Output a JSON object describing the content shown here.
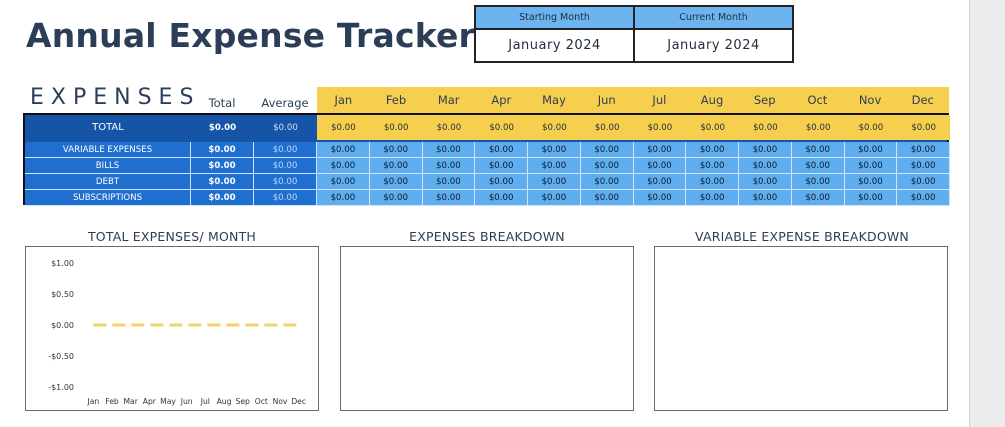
{
  "title": "Annual Expense Tracker",
  "month_box": {
    "starting_label": "Starting Month",
    "starting_value": "January  2024",
    "current_label": "Current Month",
    "current_value": "January  2024"
  },
  "table": {
    "section_label": "EXPENSES",
    "total_header": "Total",
    "average_header": "Average",
    "months": [
      "Jan",
      "Feb",
      "Mar",
      "Apr",
      "May",
      "Jun",
      "Jul",
      "Aug",
      "Sep",
      "Oct",
      "Nov",
      "Dec"
    ],
    "rows": [
      {
        "name": "TOTAL",
        "total": "$0.00",
        "average": "$0.00",
        "values": [
          "$0.00",
          "$0.00",
          "$0.00",
          "$0.00",
          "$0.00",
          "$0.00",
          "$0.00",
          "$0.00",
          "$0.00",
          "$0.00",
          "$0.00",
          "$0.00"
        ]
      },
      {
        "name": "VARIABLE EXPENSES",
        "total": "$0.00",
        "average": "$0.00",
        "values": [
          "$0.00",
          "$0.00",
          "$0.00",
          "$0.00",
          "$0.00",
          "$0.00",
          "$0.00",
          "$0.00",
          "$0.00",
          "$0.00",
          "$0.00",
          "$0.00"
        ]
      },
      {
        "name": "BILLS",
        "total": "$0.00",
        "average": "$0.00",
        "values": [
          "$0.00",
          "$0.00",
          "$0.00",
          "$0.00",
          "$0.00",
          "$0.00",
          "$0.00",
          "$0.00",
          "$0.00",
          "$0.00",
          "$0.00",
          "$0.00"
        ]
      },
      {
        "name": "DEBT",
        "total": "$0.00",
        "average": "$0.00",
        "values": [
          "$0.00",
          "$0.00",
          "$0.00",
          "$0.00",
          "$0.00",
          "$0.00",
          "$0.00",
          "$0.00",
          "$0.00",
          "$0.00",
          "$0.00",
          "$0.00"
        ]
      },
      {
        "name": "SUBSCRIPTIONS",
        "total": "$0.00",
        "average": "$0.00",
        "values": [
          "$0.00",
          "$0.00",
          "$0.00",
          "$0.00",
          "$0.00",
          "$0.00",
          "$0.00",
          "$0.00",
          "$0.00",
          "$0.00",
          "$0.00",
          "$0.00"
        ]
      }
    ]
  },
  "panels": {
    "total_title": "TOTAL EXPENSES/ MONTH",
    "breakdown_title": "EXPENSES BREAKDOWN",
    "variable_title": "VARIABLE EXPENSE BREAKDOWN"
  },
  "colors": {
    "dark_blue": "#1654a7",
    "mid_blue": "#1f6fd1",
    "light_blue": "#5eaeef",
    "yellow": "#f7cf4f",
    "line_color": "#f2d36b"
  },
  "chart_data": {
    "type": "line",
    "title": "TOTAL EXPENSES/ MONTH",
    "categories": [
      "Jan",
      "Feb",
      "Mar",
      "Apr",
      "May",
      "Jun",
      "Jul",
      "Aug",
      "Sep",
      "Oct",
      "Nov",
      "Dec"
    ],
    "series": [
      {
        "values": [
          0,
          0,
          0,
          0,
          0,
          0,
          0,
          0,
          0,
          0,
          0,
          0
        ]
      }
    ],
    "y_ticks": [
      "$1.00",
      "$0.50",
      "$0.00",
      "-$0.50",
      "-$1.00"
    ],
    "ylim": [
      -1,
      1
    ],
    "line_style": "dashed",
    "grid": false,
    "legend": "none"
  }
}
